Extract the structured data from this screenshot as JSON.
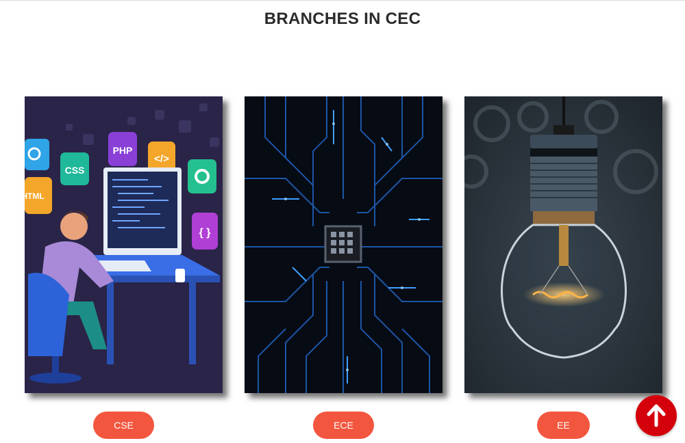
{
  "section": {
    "title": "BRANCHES IN CEC"
  },
  "branches": [
    {
      "label": "CSE",
      "image_icon": "developer-at-desk-illustration"
    },
    {
      "label": "ECE",
      "image_icon": "circuit-board-chip-image"
    },
    {
      "label": "EE",
      "image_icon": "light-bulb-image"
    }
  ],
  "cse_tiles": [
    "CSS",
    "PHP",
    "HTML"
  ],
  "scroll_button": {
    "icon": "arrow-up-icon"
  },
  "colors": {
    "pill": "#f2563e",
    "scroll_button": "#d4000b",
    "title": "#2b2b2b"
  }
}
